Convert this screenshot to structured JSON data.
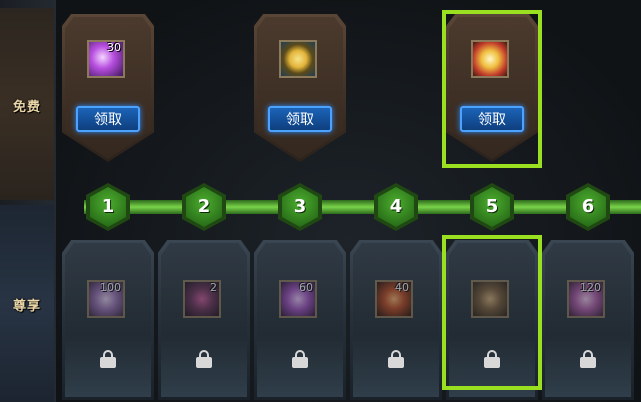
{
  "sidebar": {
    "free_label": "免费",
    "vip_label": "尊享"
  },
  "levels": [
    "1",
    "2",
    "3",
    "4",
    "5",
    "6"
  ],
  "free_rewards": [
    {
      "quantity": "30",
      "claim_label": "领取",
      "icon": "purple-crystal-icon",
      "color": "#b84fe0"
    },
    {
      "quantity": "",
      "claim_label": "领取",
      "icon": "gold-medal-icon",
      "color": "#e3b43a"
    },
    {
      "quantity": "",
      "claim_label": "领取",
      "icon": "gold-chest-icon",
      "color": "#f0c040"
    }
  ],
  "vip_rewards": [
    {
      "quantity": "100",
      "icon": "purple-fabric-icon",
      "color": "#9a6db0"
    },
    {
      "quantity": "2",
      "icon": "dark-orb-icon",
      "color": "#6b2f56"
    },
    {
      "quantity": "60",
      "icon": "purple-claw-icon",
      "color": "#a24fbf"
    },
    {
      "quantity": "40",
      "icon": "fire-orb-icon",
      "color": "#c24a1e"
    },
    {
      "quantity": "",
      "icon": "locked-chest-icon",
      "color": "#7a5a36"
    },
    {
      "quantity": "120",
      "icon": "pink-scroll-icon",
      "color": "#b25aa8"
    }
  ],
  "colors": {
    "track": "#6cc43d",
    "highlight": "#9be020",
    "claim_button": "#1b63b8"
  }
}
